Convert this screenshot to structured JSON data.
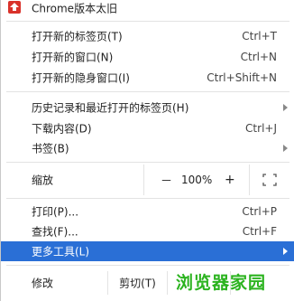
{
  "top_item": {
    "label": "Chrome版本太旧",
    "icon": "update-warning-icon",
    "icon_color": "#d9322b"
  },
  "group1": [
    {
      "label": "打开新的标签页(T)",
      "shortcut": "Ctrl+T"
    },
    {
      "label": "打开新的窗口(N)",
      "shortcut": "Ctrl+N"
    },
    {
      "label": "打开新的隐身窗口(I)",
      "shortcut": "Ctrl+Shift+N"
    }
  ],
  "group2": [
    {
      "label": "历史记录和最近打开的标签页(H)"
    },
    {
      "label": "下载内容(D)",
      "shortcut": "Ctrl+J"
    },
    {
      "label": "书签(B)"
    }
  ],
  "zoom": {
    "label": "缩放",
    "minus": "－",
    "value": "100%",
    "plus": "+",
    "fullscreen_icon": "fullscreen-icon"
  },
  "group3": [
    {
      "label": "打印(P)...",
      "shortcut": "Ctrl+P"
    },
    {
      "label": "查找(F)...",
      "shortcut": "Ctrl+F"
    },
    {
      "label": "更多工具(L)"
    }
  ],
  "edit": {
    "label": "修改",
    "cut": "剪切(T)"
  },
  "highlight_color": "#2a6fd6",
  "watermark": "浏览器家园"
}
